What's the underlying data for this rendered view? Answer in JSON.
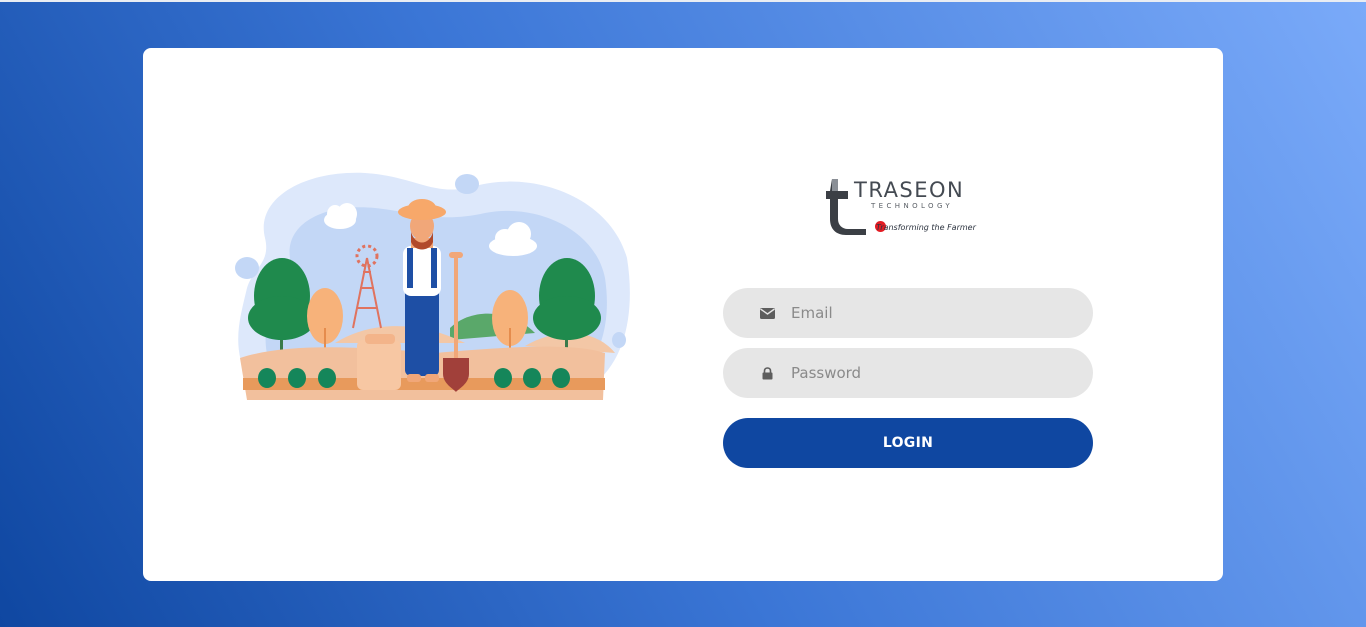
{
  "brand": {
    "name": "TRASEON",
    "subtitle": "TECHNOLOGY",
    "tagline": "Transforming the Farmer",
    "accent_color": "#e31b23"
  },
  "form": {
    "email": {
      "placeholder": "Email",
      "value": "",
      "icon": "envelope-icon"
    },
    "password": {
      "placeholder": "Password",
      "value": "",
      "icon": "lock-icon"
    },
    "login_label": "LOGIN"
  },
  "colors": {
    "primary": "#0f47a1",
    "background_gradient_start": "#0f47a1",
    "background_gradient_end": "#7aaaf9",
    "field_background": "#e6e6e6"
  }
}
